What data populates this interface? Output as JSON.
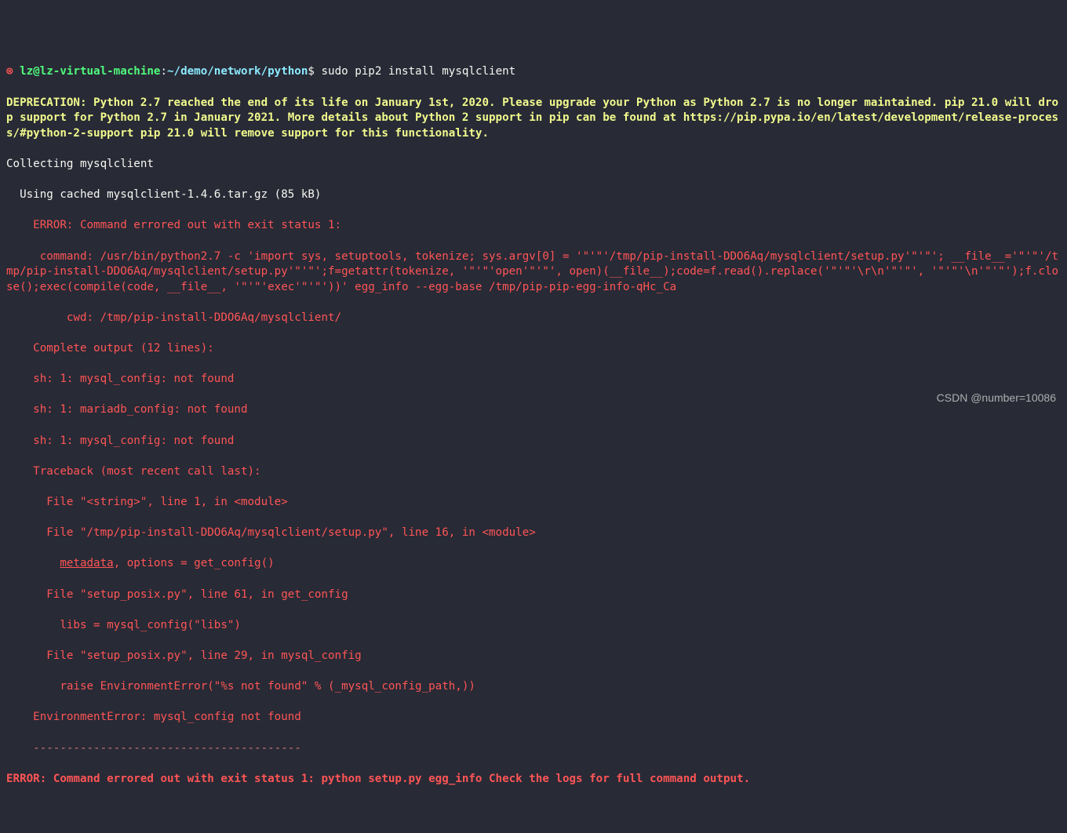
{
  "prompt": {
    "bullet": "⊗",
    "user": "lz@lz-virtual-machine",
    "sep1": ":",
    "path": "~/demo/network/python",
    "sep2": "$ ",
    "command": "sudo pip2 install mysqlclient"
  },
  "deprecation": {
    "label": "DEPRECATION:",
    "text": " Python 2.7 reached the end of its life on January 1st, 2020. Please upgrade your Python as Python 2.7 is no longer longer maintained. pip 21.0 will drop support for Python 2.7 in January 2021. More details about Python 2 support in pip can be found at https://pip.pypa.io/en/latest/development/release-process/#python-2-support pip 21.0 will remove support for this functionality.",
    "text_full": " Python 2.7 reached the end of its life on January 1st, 2020. Please upgrade your Python as Python 2.7 is no longer maintained. pip 21.0 will drop support for Python 2.7 in January 2021. More details about Python 2 support in pip can be found at https://pip.pypa.io/en/latest/development/release-process/#python-2-support pip 21.0 will remove support for this functionality."
  },
  "collecting": "Collecting mysqlclient",
  "using_cached": "  Using cached mysqlclient-1.4.6.tar.gz (85 kB)",
  "err_header": "    ERROR: Command errored out with exit status 1:",
  "err_cmd": "     command: /usr/bin/python2.7 -c 'import sys, setuptools, tokenize; sys.argv[0] = '\"'\"'/tmp/pip-install-DDO6Aq/mysqlclient/setup.py'\"'\"'; __file__='\"'\"'/tmp/pip-install-DDO6Aq/mysqlclient/setup.py'\"'\"';f=getattr(tokenize, '\"'\"'open'\"'\"', open)(__file__);code=f.read().replace('\"'\"'\\r\\n'\"'\"', '\"'\"'\\n'\"'\"');f.close();exec(compile(code, __file__, '\"'\"'exec'\"'\"'))' egg_info --egg-base /tmp/pip-pip-egg-info-qHc_Ca",
  "err_cwd": "         cwd: /tmp/pip-install-DDO6Aq/mysqlclient/",
  "err_complete": "    Complete output (12 lines):",
  "err_sh1": "    sh: 1: mysql_config: not found",
  "err_sh2": "    sh: 1: mariadb_config: not found",
  "err_sh3": "    sh: 1: mysql_config: not found",
  "err_trace": "    Traceback (most recent call last):",
  "err_f1": "      File \"<string>\", line 1, in <module>",
  "err_f2": "      File \"/tmp/pip-install-DDO6Aq/mysqlclient/setup.py\", line 16, in <module>",
  "err_meta_indent": "        ",
  "err_meta_word": "metadata",
  "err_meta_rest": ", options = get_config()",
  "err_f3": "      File \"setup_posix.py\", line 61, in get_config",
  "err_libs": "        libs = mysql_config(\"libs\")",
  "err_f4": "      File \"setup_posix.py\", line 29, in mysql_config",
  "err_raise": "        raise EnvironmentError(\"%s not found\" % (_mysql_config_path,))",
  "err_env": "    EnvironmentError: mysql_config not found",
  "err_dash": "    ----------------------------------------",
  "err_final": "ERROR: Command errored out with exit status 1: python setup.py egg_info Check the logs for full command output.",
  "watermark": "CSDN @number=10086"
}
